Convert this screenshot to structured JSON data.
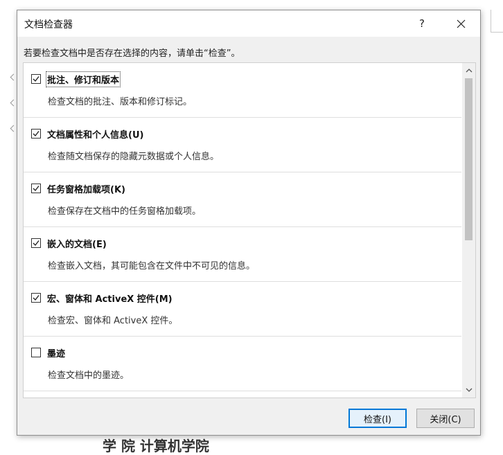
{
  "background": {
    "doc_text": "学    院   计算机学院"
  },
  "dialog": {
    "title": "文档检查器",
    "help_label": "?",
    "instruction": "若要检查文档中是否存在选择的内容，请单击“检查”。",
    "items": [
      {
        "title": "批注、修订和版本",
        "description": "检查文档的批注、版本和修订标记。",
        "checked": true
      },
      {
        "title": "文档属性和个人信息(U)",
        "description": "检查随文档保存的隐藏元数据或个人信息。",
        "checked": true
      },
      {
        "title": "任务窗格加载项(K)",
        "description": "检查保存在文档中的任务窗格加载项。",
        "checked": true
      },
      {
        "title": "嵌入的文档(E)",
        "description": "检查嵌入文档，其可能包含在文件中不可见的信息。",
        "checked": true
      },
      {
        "title": "宏、窗体和 ActiveX 控件(M)",
        "description": "检查宏、窗体和 ActiveX 控件。",
        "checked": true
      },
      {
        "title": "墨迹",
        "description": "检查文档中的墨迹。",
        "checked": false
      }
    ],
    "buttons": {
      "inspect": "检查(I)",
      "close": "关闭(C)"
    },
    "colors": {
      "accent": "#0078d7",
      "background": "#f0f0f0"
    },
    "icons": {
      "help": "help-icon",
      "close": "close-icon",
      "check": "checkmark-icon",
      "scroll_up": "chevron-up-icon",
      "scroll_down": "chevron-down-icon"
    }
  }
}
